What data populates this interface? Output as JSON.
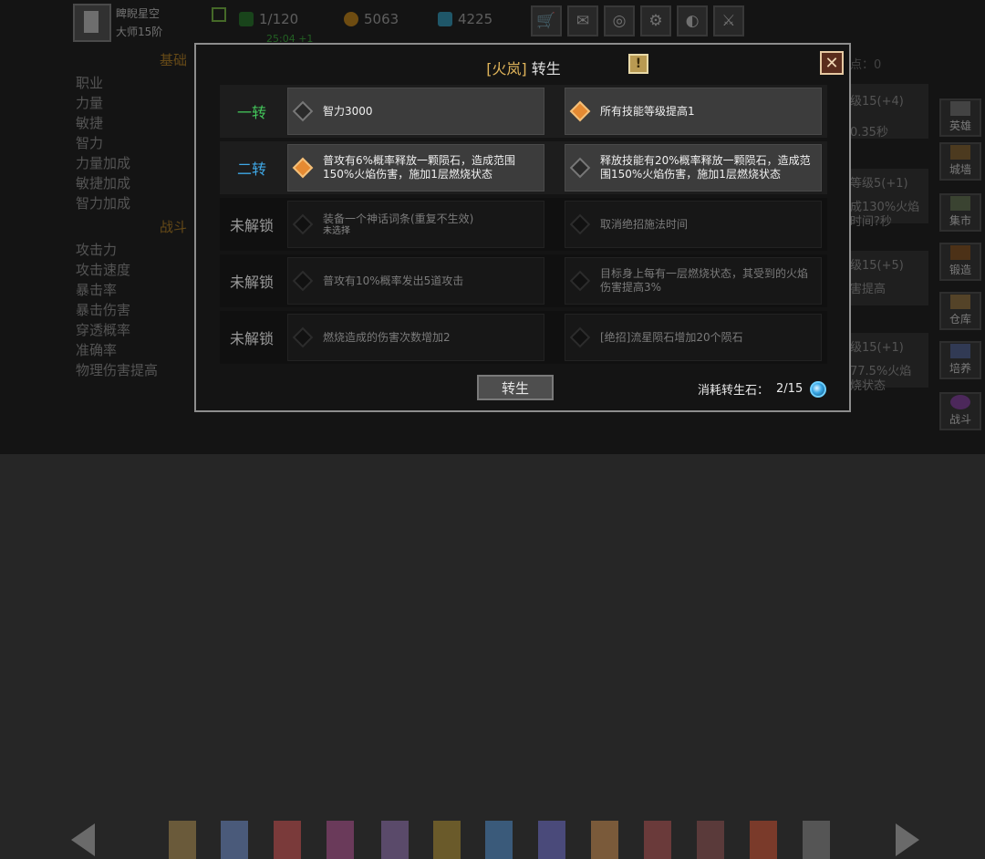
{
  "player": {
    "name": "睥睨星空",
    "rank": "大师15阶"
  },
  "stats": {
    "energy": "1/120",
    "energy_timer": "25:04 +1",
    "gold": "5063",
    "gems": "4225"
  },
  "left_panel": {
    "section1": "基础",
    "attrs1": [
      "职业",
      "力量",
      "敏捷",
      "智力",
      "力量加成",
      "敏捷加成",
      "智力加成"
    ],
    "section2": "战斗",
    "attrs2": [
      "攻击力",
      "攻击速度",
      "暴击率",
      "暴击伤害",
      "穿透概率",
      "准确率",
      "物理伤害提高"
    ]
  },
  "right_fragments": {
    "points": "点：0",
    "f1": "级15(+4)",
    "f2": "0.35秒",
    "f3": "等级5(+1)",
    "f4": "成130%火焰",
    "f5": "时间?秒",
    "f6": "级15(+5)",
    "f7": "害提高",
    "f8": "级15(+1)",
    "f9": "77.5%火焰",
    "f10": "烧状态"
  },
  "side_nav": [
    "英雄",
    "城墙",
    "集市",
    "锻造",
    "仓库",
    "培养",
    "战斗"
  ],
  "dialog": {
    "hero_tag": "[火岚]",
    "title": "转生",
    "rows": [
      {
        "label": "一转",
        "left": {
          "text": "智力3000"
        },
        "right": {
          "text": "所有技能等级提高1"
        }
      },
      {
        "label": "二转",
        "left": {
          "text": "普攻有6%概率释放一颗陨石，造成范围150%火焰伤害，施加1层燃烧状态"
        },
        "right": {
          "text": "释放技能有20%概率释放一颗陨石，造成范围150%火焰伤害，施加1层燃烧状态"
        }
      },
      {
        "label": "未解锁",
        "left": {
          "text": "装备一个神话词条(重复不生效)",
          "sub": "未选择"
        },
        "right": {
          "text": "取消绝招施法时间"
        }
      },
      {
        "label": "未解锁",
        "left": {
          "text": "普攻有10%概率发出5道攻击"
        },
        "right": {
          "text": "目标身上每有一层燃烧状态，其受到的火焰伤害提高3%"
        }
      },
      {
        "label": "未解锁",
        "left": {
          "text": "燃烧造成的伤害次数增加2"
        },
        "right": {
          "text": "[绝招]流星陨石增加20个陨石"
        }
      }
    ],
    "button": "转生",
    "cost_label": "消耗转生石：",
    "cost_value": "2/15"
  },
  "colors": {
    "tier1": "#43c55a",
    "tier2": "#3fa8e6",
    "selected": "#e58a32"
  }
}
